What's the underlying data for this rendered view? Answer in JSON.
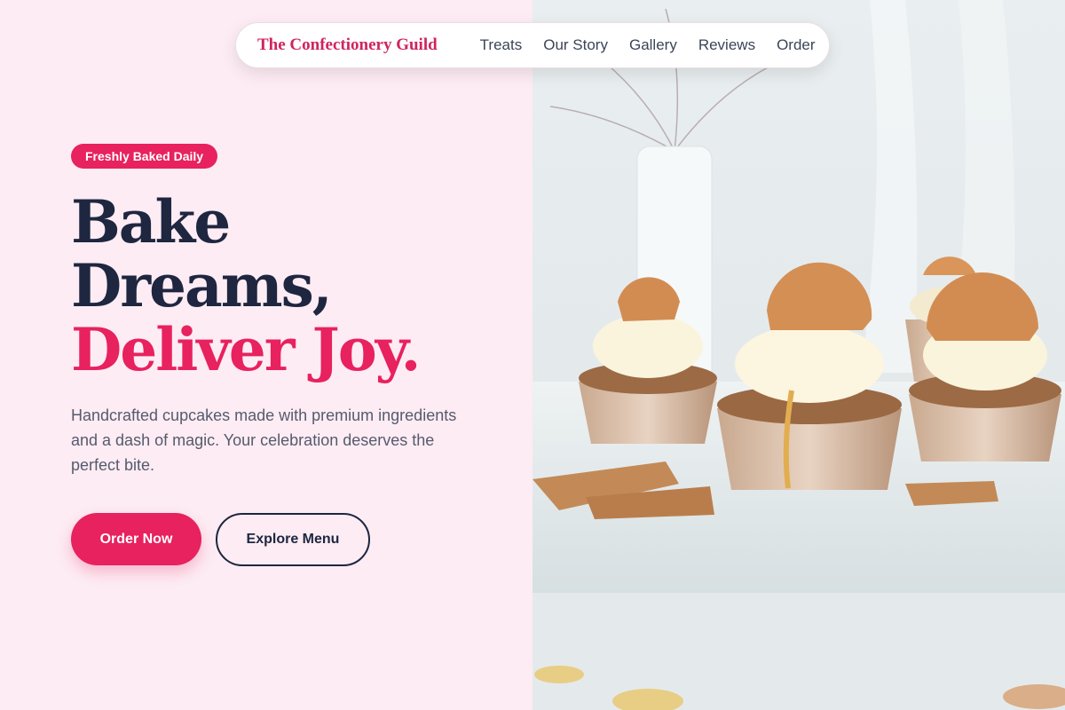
{
  "nav": {
    "brand": "The Confectionery Guild",
    "links": [
      "Treats",
      "Our Story",
      "Gallery",
      "Reviews",
      "Order"
    ]
  },
  "hero": {
    "badge": "Freshly Baked Daily",
    "headline_line1": "Bake",
    "headline_line2": "Dreams,",
    "headline_accent": "Deliver Joy.",
    "description": "Handcrafted cupcakes made with premium ingredients and a dash of magic. Your celebration deserves the perfect bite.",
    "primary_button": "Order Now",
    "secondary_button": "Explore Menu"
  },
  "image": {
    "subject": "cupcakes with cream frosting and waffle cookie toppers on marble"
  },
  "colors": {
    "accent": "#e8215f",
    "dark": "#1e2640",
    "background": "#fdecf3"
  }
}
